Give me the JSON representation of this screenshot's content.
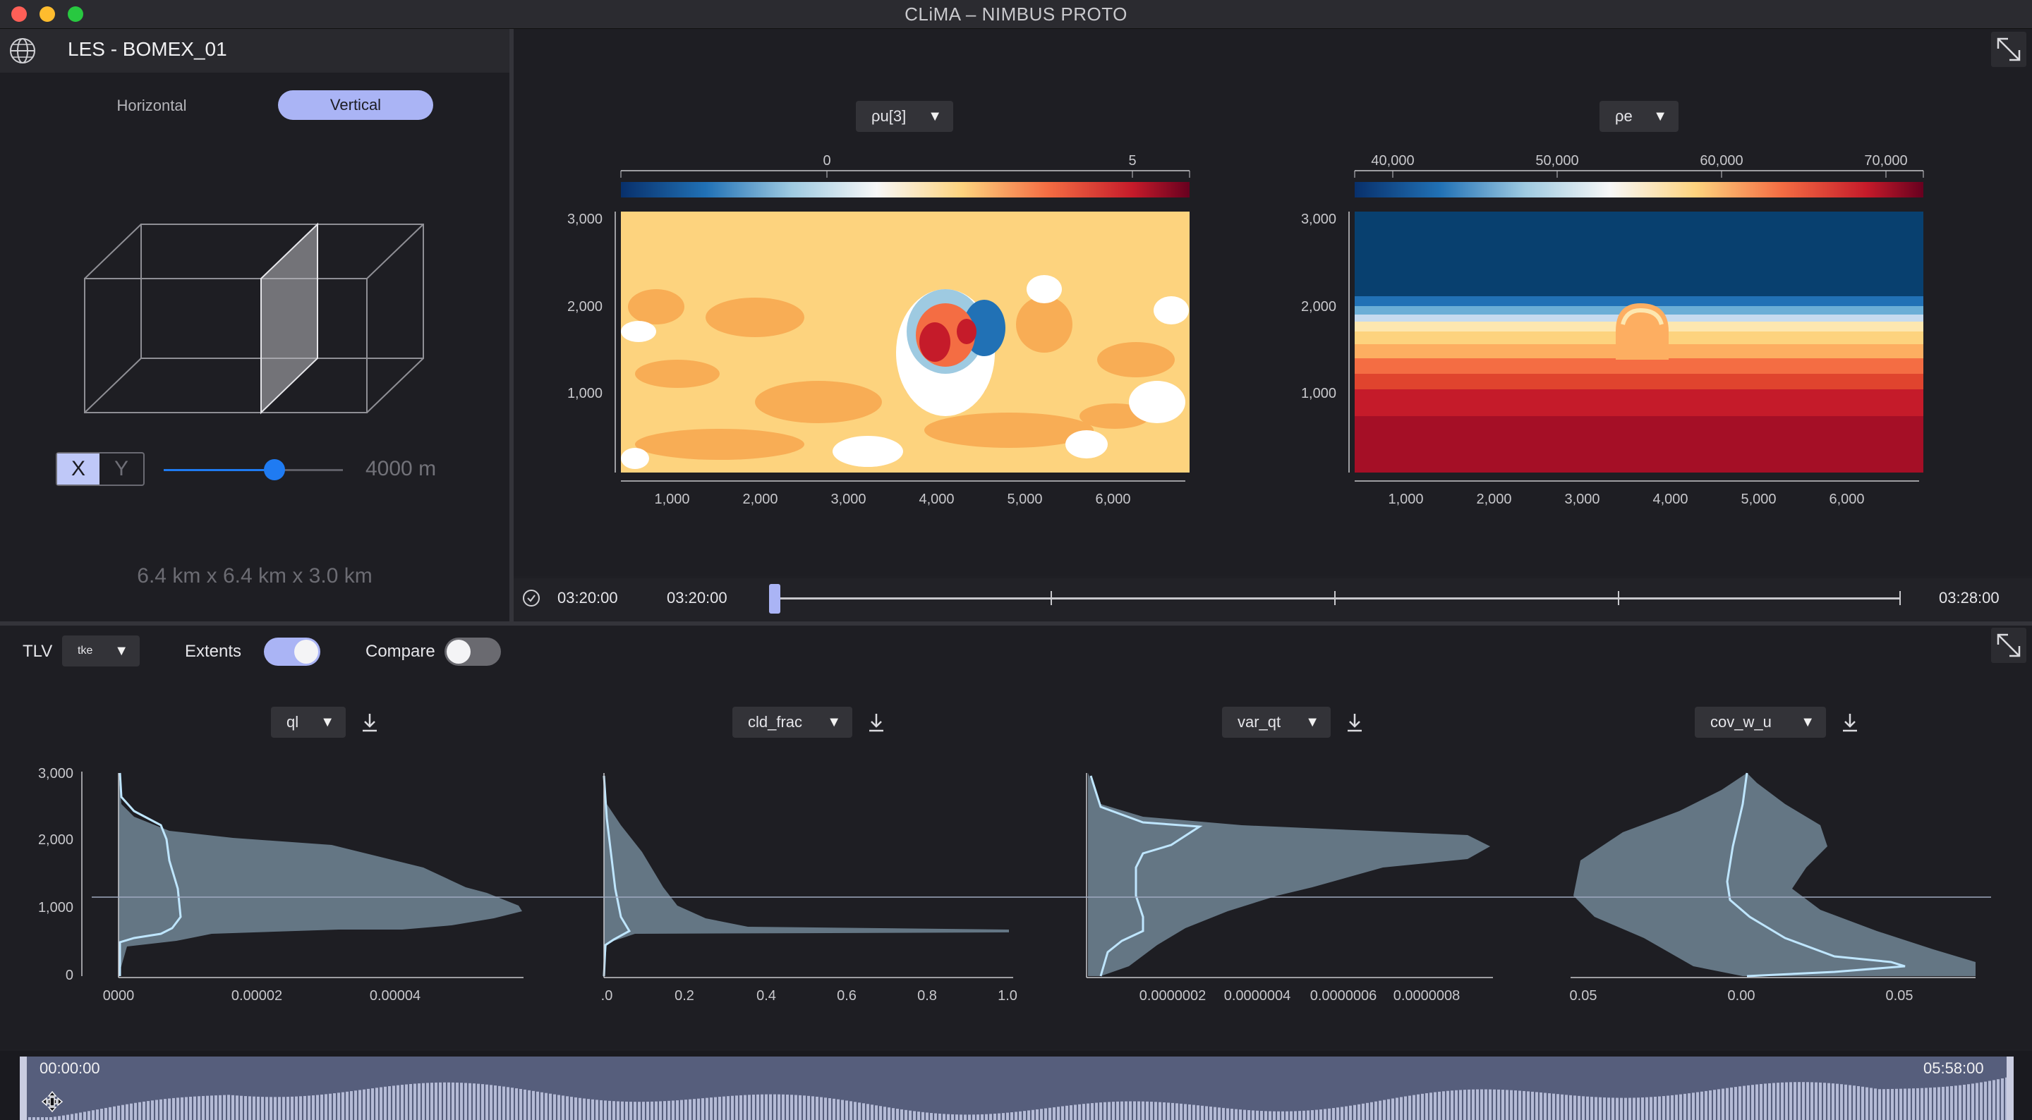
{
  "window": {
    "title": "CLiMA – NIMBUS PROTO"
  },
  "left_panel": {
    "title": "LES - BOMEX_01",
    "view_tabs": [
      "Horizontal",
      "Vertical"
    ],
    "active_tab": "Vertical",
    "axis_toggle": [
      "X",
      "Y"
    ],
    "active_axis": "X",
    "slider_value": "4000 m",
    "slider_fraction": 0.62,
    "domain_size": "6.4 km x 6.4 km x 3.0 km"
  },
  "heatmaps": {
    "left": {
      "variable": "ρu[3]",
      "colorbar_ticks": [
        "0",
        "5"
      ],
      "y_ticks": [
        "3,000",
        "2,000",
        "1,000"
      ],
      "x_ticks": [
        "1,000",
        "2,000",
        "3,000",
        "4,000",
        "5,000",
        "6,000"
      ]
    },
    "right": {
      "variable": "ρe",
      "colorbar_ticks": [
        "40,000",
        "50,000",
        "60,000",
        "70,000"
      ],
      "y_ticks": [
        "3,000",
        "2,000",
        "1,000"
      ],
      "x_ticks": [
        "1,000",
        "2,000",
        "3,000",
        "4,000",
        "5,000",
        "6,000"
      ]
    }
  },
  "timeline": {
    "start": "03:20:00",
    "current": "03:20:00",
    "end": "03:28:00",
    "position_fraction": 0.0
  },
  "profiles_toolbar": {
    "tlv_label": "TLV",
    "tlv_value": "tke",
    "extents_label": "Extents",
    "extents_on": true,
    "compare_label": "Compare",
    "compare_on": false
  },
  "profiles": [
    {
      "variable": "ql",
      "y_ticks": [
        "3,000",
        "2,000",
        "1,000",
        "0"
      ],
      "x_ticks": [
        "0000",
        "0.00002",
        "0.00004"
      ]
    },
    {
      "variable": "cld_frac",
      "x_ticks": [
        ".0",
        "0.2",
        "0.4",
        "0.6",
        "0.8",
        "1.0"
      ]
    },
    {
      "variable": "var_qt",
      "x_ticks": [
        "0.0000002",
        "0.0000004",
        "0.0000006",
        "0.0000008"
      ]
    },
    {
      "variable": "cov_w_u",
      "x_ticks": [
        "0.05",
        "0.00",
        "0.05"
      ]
    }
  ],
  "bottom_timeline": {
    "start": "00:00:00",
    "end": "05:58:00"
  },
  "colors": {
    "accent": "#aab4f5",
    "profile_fill": "#6b7f8f",
    "profile_line": "#bfe6ff",
    "slider_blue": "#1f7bf2"
  },
  "icons": [
    "globe-icon",
    "expand-icon",
    "clock-icon",
    "download-icon",
    "move-icon"
  ]
}
